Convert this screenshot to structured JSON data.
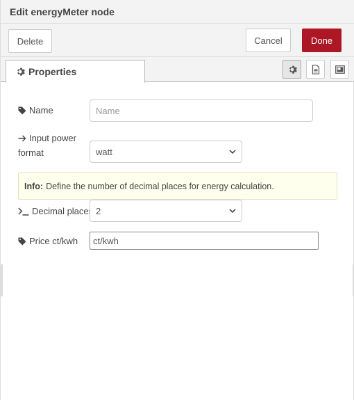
{
  "header": {
    "title": "Edit energyMeter node"
  },
  "toolbar": {
    "delete_label": "Delete",
    "cancel_label": "Cancel",
    "done_label": "Done"
  },
  "tabs": {
    "properties_label": "Properties"
  },
  "form": {
    "name": {
      "label": "Name",
      "placeholder": "Name"
    },
    "input_power": {
      "label_line1": "Input power",
      "label_line2": "format",
      "value": "watt"
    },
    "info": {
      "bold": "Info:",
      "text": "Define the number of decimal places for energy calculation."
    },
    "decimal": {
      "label": "Decimal places",
      "value": "2"
    },
    "price": {
      "label": "Price ct/kwh",
      "value": "ct/kwh"
    }
  },
  "icons": [
    "gear-icon",
    "tag-icon",
    "arrow-right-icon",
    "terminal-icon",
    "document-icon",
    "image-icon",
    "chevron-down-icon"
  ],
  "colors": {
    "done": "#ad1625",
    "info_bg": "#ffffee"
  }
}
